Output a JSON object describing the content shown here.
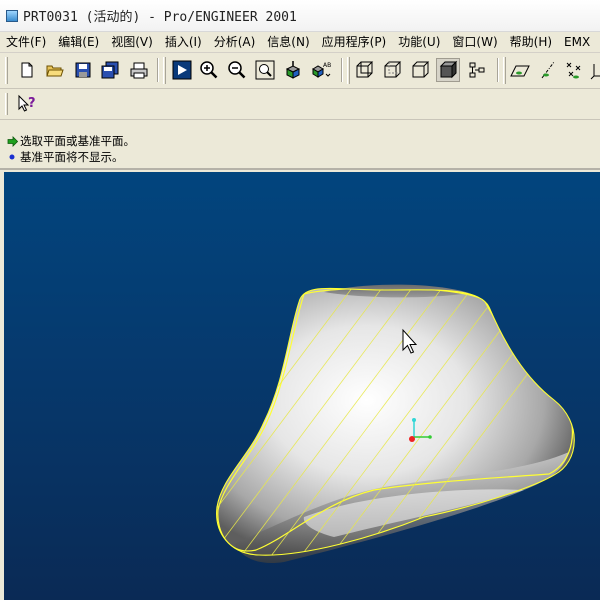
{
  "window": {
    "title": "PRT0031 (活动的) - Pro/ENGINEER 2001"
  },
  "menu": [
    "文件(F)",
    "编辑(E)",
    "视图(V)",
    "插入(I)",
    "分析(A)",
    "信息(N)",
    "应用程序(P)",
    "功能(U)",
    "窗口(W)",
    "帮助(H)",
    "EMX"
  ],
  "toolbar1": [
    {
      "name": "new-file-icon"
    },
    {
      "name": "open-folder-icon"
    },
    {
      "name": "save-icon"
    },
    {
      "name": "save-copy-icon"
    },
    {
      "name": "print-icon"
    },
    {
      "name": "repaint-icon"
    },
    {
      "name": "zoom-in-icon"
    },
    {
      "name": "zoom-out-icon"
    },
    {
      "name": "refit-icon"
    },
    {
      "name": "orient-icon"
    },
    {
      "name": "saved-views-icon"
    },
    {
      "name": "wireframe-icon"
    },
    {
      "name": "hidden-line-icon"
    },
    {
      "name": "no-hidden-icon"
    },
    {
      "name": "shading-icon",
      "pressed": true
    },
    {
      "name": "model-tree-icon"
    },
    {
      "name": "datum-plane-icon"
    },
    {
      "name": "datum-axis-icon"
    },
    {
      "name": "datum-point-icon"
    },
    {
      "name": "coordinate-system-icon"
    }
  ],
  "toolbar2": [
    {
      "name": "context-help-icon"
    }
  ],
  "messages": [
    {
      "icon": "prompt-arrow-icon",
      "text": "选取平面或基准平面。"
    },
    {
      "icon": "info-dot-icon",
      "text": "基准平面将不显示。"
    }
  ],
  "colors": {
    "background_top": "#02457e",
    "background_bottom": "#0a2a55",
    "surface_highlight": "#ffff33",
    "prompt_arrow": "#1fa11f",
    "info_dot": "#1a2fd0"
  }
}
